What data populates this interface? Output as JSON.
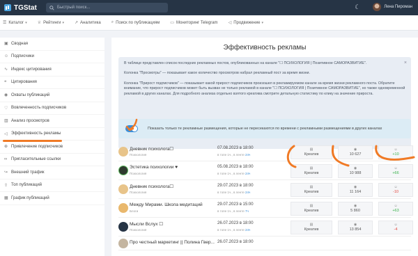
{
  "app": {
    "name": "TGStat",
    "search_placeholder": "Быстрый поиск...",
    "user": "Лена Пироман",
    "accent": "#f07a25"
  },
  "menu": [
    {
      "label": "Каталог",
      "icon": "list-icon"
    },
    {
      "label": "Рейтинги",
      "icon": "trophy-icon"
    },
    {
      "label": "Аналитика",
      "icon": "chart-icon"
    },
    {
      "label": "Поиск по публикациям",
      "icon": "search-icon"
    },
    {
      "label": "Мониторинг Telegram",
      "icon": "monitor-icon"
    },
    {
      "label": "Продвижение",
      "icon": "megaphone-icon"
    }
  ],
  "sidebar": [
    "Сводная",
    "Подписчики",
    "Индекс цитирования",
    "Цитирования",
    "Охваты публикаций",
    "Вовлеченность подписчиков",
    "Анализ просмотров",
    "Эффективность рекламы",
    "Привлечение подписчиков",
    "Пригласительные ссылки",
    "Внешний трафик",
    "Топ публикаций",
    "График публикаций"
  ],
  "page": {
    "title": "Эффективность рекламы",
    "info1": "В таблице представлен список последних рекламных постов, опубликованных на канале \"☐ ПСИХОЛОГИЯ | Позитивное САМОРАЗВИТИЕ\".",
    "info2": "Колонка \"Просмотры\" — показывает какое количество просмотров набрал рекламный пост за время жизни.",
    "info3": "Колонка \"Прирост подписчиков\" — показывает какой прирост подписчиков произошел в рекламируемом канале за время жизни рекламного поста. Обратите внимание, что прирост подписчиков может быть вызван не только рекламой в канале \"☐ ПСИХОЛОГИЯ | Позитивное САМОРАЗВИТИЕ\", но также одновременной рекламой в других каналах. Для подробного анализа отдельно взятого креатива смотрите детальную статистику по клику на значение прироста.",
    "toggle_label": "Показать только те рекламные размещения, которые не пересекаются по времени с рекламными размещениями в других каналах"
  },
  "rows": [
    {
      "name": "Дневник психолога☐",
      "cat": "Психология",
      "date": "07.08.2023 в 18:00",
      "meta_pre": "в топе 1ч., в ленте ",
      "meta_hl": "24ч",
      "views": "10 627",
      "growth": "+10",
      "growth_pos": true,
      "av": "#e8c48a"
    },
    {
      "name": "Эстетика психологии ♥",
      "cat": "Психология",
      "date": "05.08.2023 в 18:00",
      "meta_pre": "в топе 1ч., в ленте ",
      "meta_hl": "24ч",
      "views": "10 988",
      "growth": "+66",
      "growth_pos": true,
      "av": "#2f3a2f"
    },
    {
      "name": "Дневник психолога☐",
      "cat": "Психология",
      "date": "29.07.2023 в 18:00",
      "meta_pre": "в топе 1ч., в ленте ",
      "meta_hl": "24ч",
      "views": "11 164",
      "growth": "-10",
      "growth_pos": false,
      "av": "#e8c48a"
    },
    {
      "name": "Между Мирами. Школа медитаций",
      "cat": "Блоги",
      "date": "29.07.2023 в 15:00",
      "meta_pre": "в топе 1ч., в ленте ",
      "meta_hl": "7ч",
      "views": "5 860",
      "growth": "+63",
      "growth_pos": true,
      "av": "#e9b86d"
    },
    {
      "name": "Мысли Вслух ☐",
      "cat": "Психология",
      "date": "26.07.2023 в 18:00",
      "meta_pre": "в топе 1ч., в ленте ",
      "meta_hl": "24ч",
      "views": "13 854",
      "growth": "-4",
      "growth_pos": false,
      "av": "#263445"
    },
    {
      "name": "Про честный маркетинг || Полина Гвер...",
      "cat": "",
      "date": "26.07.2023 в 18:00",
      "meta_pre": "",
      "meta_hl": "",
      "views": "",
      "growth": "",
      "growth_pos": true,
      "av": "#c4b5a0"
    }
  ],
  "cell_label": "Креатив"
}
